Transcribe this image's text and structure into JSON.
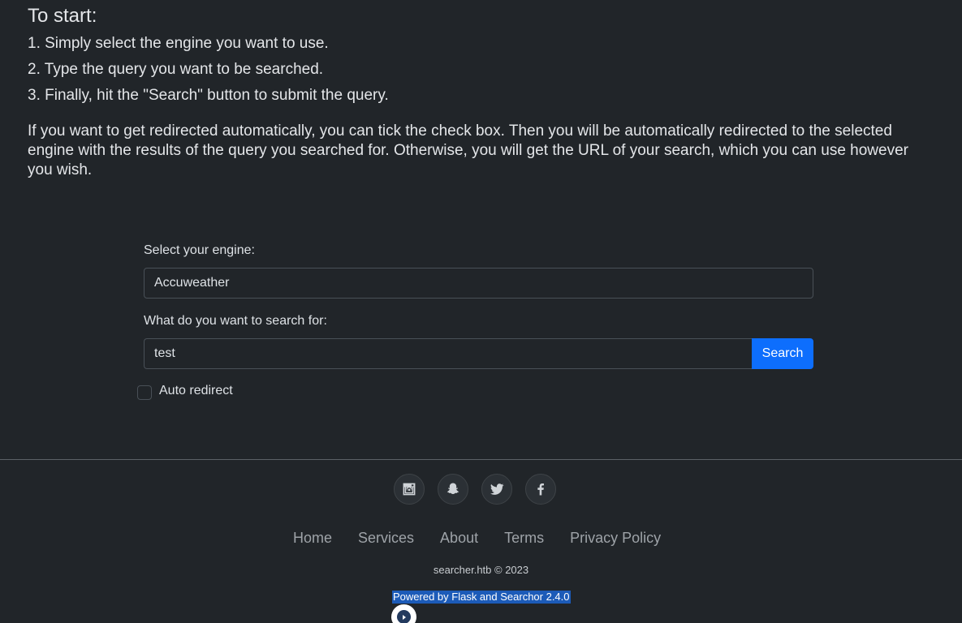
{
  "instructions": {
    "title": "To start:",
    "steps": [
      "1. Simply select the engine you want to use.",
      "2. Type the query you want to be searched.",
      "3. Finally, hit the \"Search\" button to submit the query."
    ],
    "redirect_note": "If you want to get redirected automatically, you can tick the check box. Then you will be automatically redirected to the selected engine with the results of the query you searched for. Otherwise, you will get the URL of your search, which you can use however you wish."
  },
  "form": {
    "engine_label": "Select your engine:",
    "engine_value": "Accuweather",
    "query_label": "What do you want to search for:",
    "query_value": "test",
    "search_button": "Search",
    "auto_redirect_label": "Auto redirect",
    "auto_redirect_checked": false
  },
  "footer": {
    "socials": [
      "instagram-icon",
      "snapchat-icon",
      "twitter-icon",
      "facebook-icon"
    ],
    "links": [
      "Home",
      "Services",
      "About",
      "Terms",
      "Privacy Policy"
    ],
    "copyright": "searcher.htb © 2023",
    "powered_by": "Powered by Flask and Searchor 2.4.0"
  },
  "colors": {
    "background": "#212529",
    "accent": "#0d6efd",
    "selection": "#1c5bb8"
  }
}
